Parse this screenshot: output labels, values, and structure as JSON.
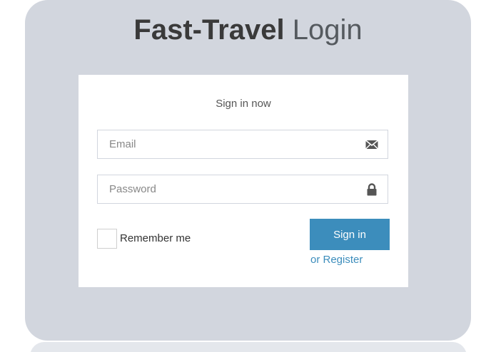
{
  "logo": {
    "brand": "Fast-Travel",
    "suffix": " Login"
  },
  "login_box": {
    "message": "Sign in now",
    "email": {
      "placeholder": "Email",
      "value": "",
      "icon": "envelope-icon"
    },
    "password": {
      "placeholder": "Password",
      "value": "",
      "icon": "lock-icon"
    },
    "remember_label": "Remember me",
    "remember_checked": false,
    "signin_label": "Sign in",
    "register_label": "or Register"
  },
  "colors": {
    "panel_background": "#d2d6de",
    "primary_button": "#3c8dbc",
    "link": "#3c8dbc",
    "box_background": "#ffffff"
  }
}
